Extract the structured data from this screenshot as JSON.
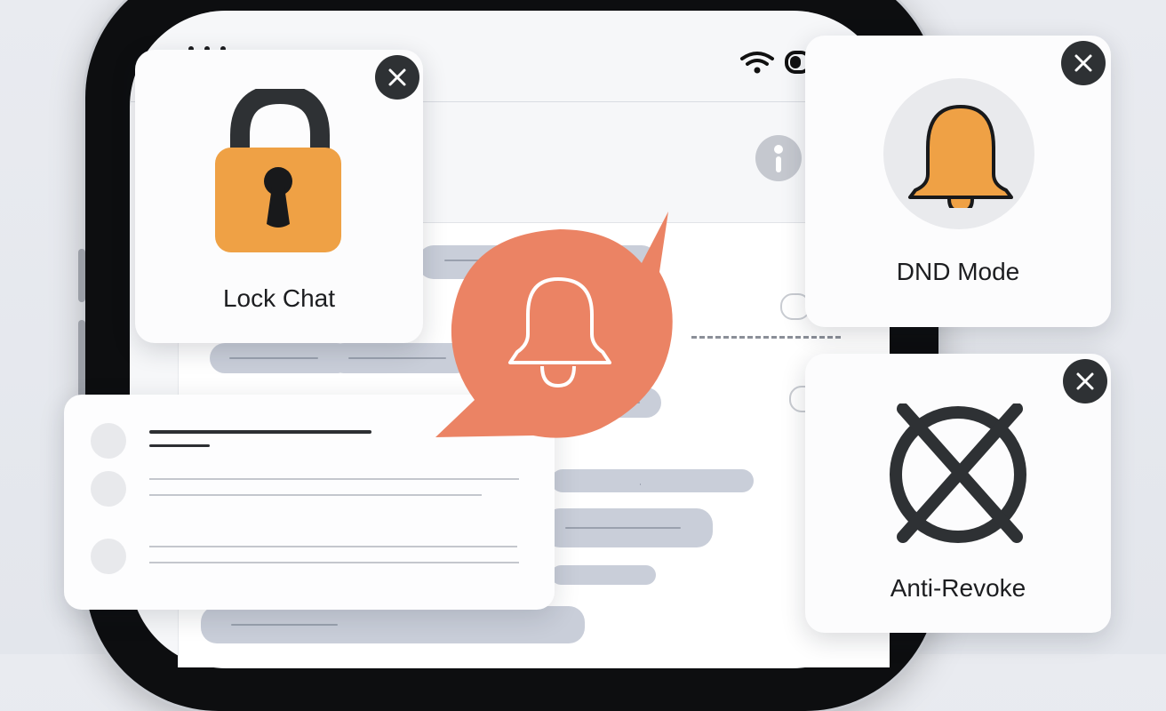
{
  "cards": {
    "lock_chat": {
      "label": "Lock Chat",
      "icon": "padlock-icon"
    },
    "dnd_mode": {
      "label": "DND Mode",
      "icon": "bell-icon"
    },
    "anti_revoke": {
      "label": "Anti-Revoke",
      "icon": "crossed-circle-icon"
    }
  },
  "center_badge": {
    "icon": "bell-outline-icon"
  },
  "colors": {
    "accent_orange": "#eb8364",
    "icon_orange": "#efa145",
    "dark": "#2e3134"
  }
}
